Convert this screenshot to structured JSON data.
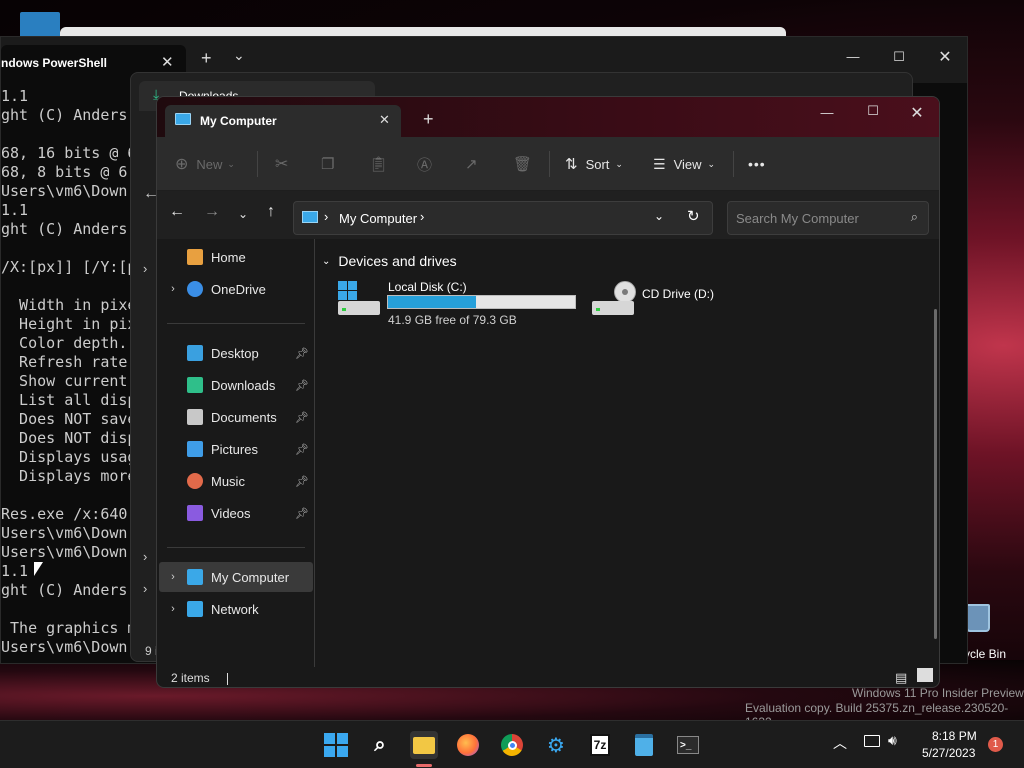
{
  "desktop": {
    "watermark_line1": "Windows 11 Pro Insider Preview",
    "watermark_line2": "Evaluation copy. Build 25375.zn_release.230520-1632",
    "recycle_bin_label": "ycle Bin"
  },
  "terminal": {
    "tab_title": "ndows PowerShell",
    "new_tab": "+",
    "dropdown": "⌄",
    "lines": [
      "1.1",
      "ght (C) Anders",
      "",
      "68, 16 bits @ 6",
      "68, 8 bits @ 6",
      "Users\\vm6\\Down",
      "1.1",
      "ght (C) Anders",
      "",
      "/X:[px]] [/Y:[p",
      "",
      "  Width in pixe",
      "  Height in pix",
      "  Color depth.",
      "  Refresh rate",
      "  Show current",
      "  List all disp",
      "  Does NOT save",
      "  Does NOT disp",
      "  Displays usag",
      "  Displays more",
      "",
      "Res.exe /x:640",
      "Users\\vm6\\Down",
      "Users\\vm6\\Down",
      "1.1",
      "ght (C) Anders",
      "",
      " The graphics m",
      "Users\\vm6\\Down"
    ]
  },
  "back_explorer": {
    "tab_title": "Downloads",
    "status_fragment": "9 i"
  },
  "explorer": {
    "tab_title": "My Computer",
    "new_tab": "+",
    "toolbar": {
      "new_label": "New",
      "sort_label": "Sort",
      "view_label": "View",
      "more_label": "•••"
    },
    "breadcrumb": [
      "My Computer"
    ],
    "search_placeholder": "Search My Computer",
    "sidebar": {
      "top": [
        {
          "label": "Home",
          "color": "#e8a040"
        },
        {
          "label": "OneDrive",
          "color": "#3a8ee6"
        }
      ],
      "pinned": [
        {
          "label": "Desktop",
          "color": "#3aa0e0"
        },
        {
          "label": "Downloads",
          "color": "#2fbf8a"
        },
        {
          "label": "Documents",
          "color": "#c8c8c8"
        },
        {
          "label": "Pictures",
          "color": "#3f9de8"
        },
        {
          "label": "Music",
          "color": "#e26a4a"
        },
        {
          "label": "Videos",
          "color": "#8a5be0"
        }
      ],
      "bottom": [
        {
          "label": "My Computer",
          "color": "#3aa8e8"
        },
        {
          "label": "Network",
          "color": "#3aa8e8"
        }
      ]
    },
    "section_title": "Devices and drives",
    "drives": [
      {
        "name": "Local Disk (C:)",
        "free_text": "41.9 GB free of 79.3 GB",
        "used_fraction": 0.47
      },
      {
        "name": "CD Drive (D:)"
      }
    ],
    "status": "2 items"
  },
  "taskbar": {
    "time": "8:18 PM",
    "date": "5/27/2023",
    "notification_count": "1",
    "sevenzip_label": "7z"
  }
}
